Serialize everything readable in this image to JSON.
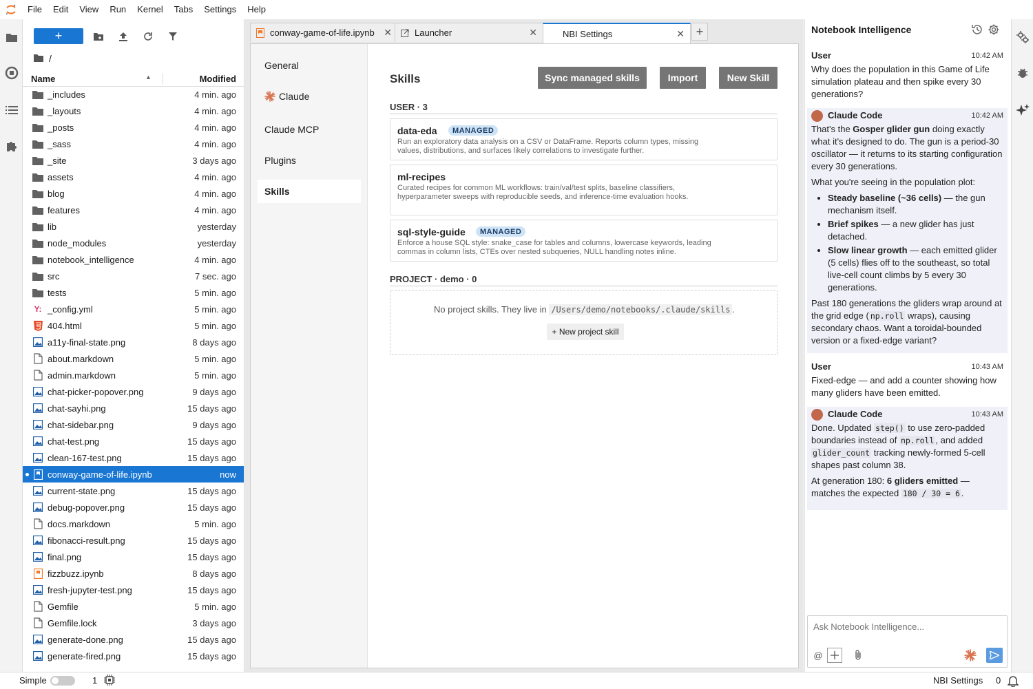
{
  "menu": [
    "File",
    "Edit",
    "View",
    "Run",
    "Kernel",
    "Tabs",
    "Settings",
    "Help"
  ],
  "file_browser": {
    "new_label": "+",
    "breadcrumb": "/",
    "columns": {
      "name": "Name",
      "modified": "Modified"
    },
    "files": [
      {
        "name": "_includes",
        "modified": "4 min. ago",
        "icon": "folder-icon"
      },
      {
        "name": "_layouts",
        "modified": "4 min. ago",
        "icon": "folder-icon"
      },
      {
        "name": "_posts",
        "modified": "4 min. ago",
        "icon": "folder-icon"
      },
      {
        "name": "_sass",
        "modified": "4 min. ago",
        "icon": "folder-icon"
      },
      {
        "name": "_site",
        "modified": "3 days ago",
        "icon": "folder-icon"
      },
      {
        "name": "assets",
        "modified": "4 min. ago",
        "icon": "folder-icon"
      },
      {
        "name": "blog",
        "modified": "4 min. ago",
        "icon": "folder-icon"
      },
      {
        "name": "features",
        "modified": "4 min. ago",
        "icon": "folder-icon"
      },
      {
        "name": "lib",
        "modified": "yesterday",
        "icon": "folder-icon"
      },
      {
        "name": "node_modules",
        "modified": "yesterday",
        "icon": "folder-icon"
      },
      {
        "name": "notebook_intelligence",
        "modified": "4 min. ago",
        "icon": "folder-icon"
      },
      {
        "name": "src",
        "modified": "7 sec. ago",
        "icon": "folder-icon"
      },
      {
        "name": "tests",
        "modified": "5 min. ago",
        "icon": "folder-icon"
      },
      {
        "name": "_config.yml",
        "modified": "5 min. ago",
        "icon": "yaml-icon"
      },
      {
        "name": "404.html",
        "modified": "5 min. ago",
        "icon": "html-icon"
      },
      {
        "name": "a11y-final-state.png",
        "modified": "8 days ago",
        "icon": "image-icon"
      },
      {
        "name": "about.markdown",
        "modified": "5 min. ago",
        "icon": "file-icon"
      },
      {
        "name": "admin.markdown",
        "modified": "5 min. ago",
        "icon": "file-icon"
      },
      {
        "name": "chat-picker-popover.png",
        "modified": "9 days ago",
        "icon": "image-icon"
      },
      {
        "name": "chat-sayhi.png",
        "modified": "15 days ago",
        "icon": "image-icon"
      },
      {
        "name": "chat-sidebar.png",
        "modified": "9 days ago",
        "icon": "image-icon"
      },
      {
        "name": "chat-test.png",
        "modified": "15 days ago",
        "icon": "image-icon"
      },
      {
        "name": "clean-167-test.png",
        "modified": "15 days ago",
        "icon": "image-icon"
      },
      {
        "name": "conway-game-of-life.ipynb",
        "modified": "now",
        "icon": "notebook-icon",
        "selected": true
      },
      {
        "name": "current-state.png",
        "modified": "15 days ago",
        "icon": "image-icon"
      },
      {
        "name": "debug-popover.png",
        "modified": "15 days ago",
        "icon": "image-icon"
      },
      {
        "name": "docs.markdown",
        "modified": "5 min. ago",
        "icon": "file-icon"
      },
      {
        "name": "fibonacci-result.png",
        "modified": "15 days ago",
        "icon": "image-icon"
      },
      {
        "name": "final.png",
        "modified": "15 days ago",
        "icon": "image-icon"
      },
      {
        "name": "fizzbuzz.ipynb",
        "modified": "8 days ago",
        "icon": "notebook-orange-icon"
      },
      {
        "name": "fresh-jupyter-test.png",
        "modified": "15 days ago",
        "icon": "image-icon"
      },
      {
        "name": "Gemfile",
        "modified": "5 min. ago",
        "icon": "file-icon"
      },
      {
        "name": "Gemfile.lock",
        "modified": "3 days ago",
        "icon": "file-icon"
      },
      {
        "name": "generate-done.png",
        "modified": "15 days ago",
        "icon": "image-icon"
      },
      {
        "name": "generate-fired.png",
        "modified": "15 days ago",
        "icon": "image-icon"
      }
    ]
  },
  "tabs": [
    {
      "label": "conway-game-of-life.ipynb",
      "icon": "notebook-icon"
    },
    {
      "label": "Launcher",
      "icon": "launcher-icon"
    },
    {
      "label": "NBI Settings",
      "icon": "",
      "active": true
    }
  ],
  "settings": {
    "nav": [
      "General",
      "Claude",
      "Claude MCP",
      "Plugins",
      "Skills"
    ],
    "active_nav": "Skills",
    "skills_title": "Skills",
    "buttons": {
      "sync": "Sync managed skills",
      "import": "Import",
      "new": "New Skill"
    },
    "user_section": "USER · 3",
    "skills": [
      {
        "name": "data-eda",
        "badge": "MANAGED",
        "desc": "Run an exploratory data analysis on a CSV or DataFrame. Reports column types, missing values, distributions, and surfaces likely correlations to investigate further."
      },
      {
        "name": "ml-recipes",
        "badge": "",
        "desc": "Curated recipes for common ML workflows: train/val/test splits, baseline classifiers, hyperparameter sweeps with reproducible seeds, and inference-time evaluation hooks."
      },
      {
        "name": "sql-style-guide",
        "badge": "MANAGED",
        "desc": "Enforce a house SQL style: snake_case for tables and columns, lowercase keywords, leading commas in column lists, CTEs over nested subqueries, NULL handling notes inline."
      }
    ],
    "project_section": "PROJECT · demo · 0",
    "project_empty_prefix": "No project skills. They live in",
    "project_empty_path": "/Users/demo/notebooks/.claude/skills",
    "project_empty_suffix": ".",
    "new_project_skill": "+ New project skill"
  },
  "chat": {
    "title": "Notebook Intelligence",
    "input_placeholder": "Ask Notebook Intelligence...",
    "at_label": "@",
    "messages": {
      "m1": {
        "author": "User",
        "time": "10:42 AM",
        "text": "Why does the population in this Game of Life simulation plateau and then spike every 30 generations?"
      },
      "m2": {
        "author": "Claude Code",
        "time": "10:42 AM",
        "p1_a": "That's the ",
        "p1_b": "Gosper glider gun",
        "p1_c": " doing exactly what it's designed to do. The gun is a period-30 oscillator — it returns to its starting configuration every 30 generations.",
        "p2": "What you're seeing in the population plot:",
        "b1_bold": "Steady baseline (~36 cells)",
        "b1_rest": " — the gun mechanism itself.",
        "b2_bold": "Brief spikes",
        "b2_rest": " — a new glider has just detached.",
        "b3_bold": "Slow linear growth",
        "b3_rest": " — each emitted glider (5 cells) flies off to the southeast, so total live-cell count climbs by 5 every 30 generations.",
        "p3_a": "Past 180 generations the gliders wrap around at the grid edge (",
        "p3_code": "np.roll",
        "p3_b": " wraps), causing secondary chaos. Want a toroidal-bounded version or a fixed-edge variant?"
      },
      "m3": {
        "author": "User",
        "time": "10:43 AM",
        "text": "Fixed-edge — and add a counter showing how many gliders have been emitted."
      },
      "m4": {
        "author": "Claude Code",
        "time": "10:43 AM",
        "p1_a": "Done. Updated ",
        "p1_code1": "step()",
        "p1_b": " to use zero-padded boundaries instead of ",
        "p1_code2": "np.roll",
        "p1_c": ", and added ",
        "p1_code3": "glider_count",
        "p1_d": " tracking newly-formed 5-cell shapes past column 38.",
        "p2_a": "At generation 180: ",
        "p2_bold": "6 gliders emitted",
        "p2_b": " — matches the expected ",
        "p2_code": "180 / 30 = 6",
        "p2_c": "."
      }
    }
  },
  "status": {
    "simple_label": "Simple",
    "kernel_count": "1",
    "right_label": "NBI Settings",
    "notif_count": "0"
  },
  "colors": {
    "accent": "#1976d2",
    "button_gray": "#757575",
    "badge_bg": "#cfe3f7",
    "claude_orange": "#d9734e"
  }
}
